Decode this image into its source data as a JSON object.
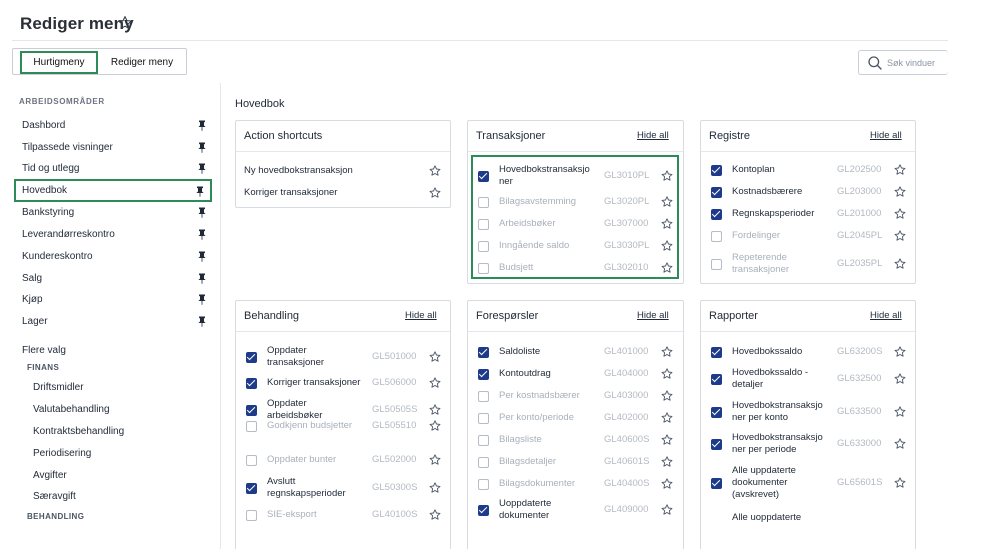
{
  "header": {
    "title": "Rediger meny"
  },
  "toolbar": {
    "tab_quick": "Hurtigmeny",
    "tab_edit": "Rediger meny"
  },
  "search": {
    "placeholder": "Søk vinduer"
  },
  "sidebar": {
    "heading": "ARBEIDSOMRÅDER",
    "items": [
      {
        "label": "Dashbord"
      },
      {
        "label": "Tilpassede visninger"
      },
      {
        "label": "Tid og utlegg"
      },
      {
        "label": "Hovedbok"
      },
      {
        "label": "Bankstyring"
      },
      {
        "label": "Leverandørreskontro"
      },
      {
        "label": "Kundereskontro"
      },
      {
        "label": "Salg"
      },
      {
        "label": "Kjøp"
      },
      {
        "label": "Lager"
      }
    ],
    "more": "Flere valg",
    "cat_finans": "FINANS",
    "finans_items": [
      "Driftsmidler",
      "Valutabehandling",
      "Kontraktsbehandling",
      "Periodisering",
      "Avgifter",
      "Særavgift"
    ],
    "cat_behandling": "BEHANDLING"
  },
  "main": {
    "section_title": "Hovedbok",
    "hide_all": "Hide all",
    "action_shortcuts": {
      "title": "Action shortcuts",
      "items": [
        "Ny hovedbokstransaksjon",
        "Korriger transaksjoner"
      ]
    },
    "transaksjoner": {
      "title": "Transaksjoner",
      "items": [
        {
          "label": "Hovedbokstransaksjo\nner",
          "code": "GL3010PL",
          "checked": true
        },
        {
          "label": "Bilagsavstemming",
          "code": "GL3020PL",
          "checked": false
        },
        {
          "label": "Arbeidsbøker",
          "code": "GL307000",
          "checked": false
        },
        {
          "label": "Inngående saldo",
          "code": "GL3030PL",
          "checked": false
        },
        {
          "label": "Budsjett",
          "code": "GL302010",
          "checked": false
        }
      ]
    },
    "registre": {
      "title": "Registre",
      "items": [
        {
          "label": "Kontoplan",
          "code": "GL202500",
          "checked": true
        },
        {
          "label": "Kostnadsbærere",
          "code": "GL203000",
          "checked": true
        },
        {
          "label": "Regnskapsperioder",
          "code": "GL201000",
          "checked": true
        },
        {
          "label": "Fordelinger",
          "code": "GL2045PL",
          "checked": false
        },
        {
          "label": "Repeterende\ntransaksjoner",
          "code": "GL2035PL",
          "checked": false
        }
      ]
    },
    "behandling": {
      "title": "Behandling",
      "items": [
        {
          "label": "Oppdater\ntransaksjoner",
          "code": "GL501000",
          "checked": true
        },
        {
          "label": "Korriger transaksjoner",
          "code": "GL506000",
          "checked": true
        },
        {
          "label": "Oppdater\narbeidsbøker",
          "code": "GL50505S",
          "checked": true
        },
        {
          "label": "Godkjenn budsjetter",
          "code": "GL505510",
          "checked": false
        },
        {
          "label": "Oppdater bunter",
          "code": "GL502000",
          "checked": false
        },
        {
          "label": "Avslutt\nregnskapsperioder",
          "code": "GL50300S",
          "checked": true
        },
        {
          "label": "SIE-eksport",
          "code": "GL40100S",
          "checked": false
        }
      ]
    },
    "foresporsler": {
      "title": "Forespørsler",
      "items": [
        {
          "label": "Saldoliste",
          "code": "GL401000",
          "checked": true
        },
        {
          "label": "Kontoutdrag",
          "code": "GL404000",
          "checked": true
        },
        {
          "label": "Per kostnadsbærer",
          "code": "GL403000",
          "checked": false
        },
        {
          "label": "Per konto/periode",
          "code": "GL402000",
          "checked": false
        },
        {
          "label": "Bilagsliste",
          "code": "GL40600S",
          "checked": false
        },
        {
          "label": "Bilagsdetaljer",
          "code": "GL40601S",
          "checked": false
        },
        {
          "label": "Bilagsdokumenter",
          "code": "GL40400S",
          "checked": false
        },
        {
          "label": "Uoppdaterte\ndokumenter",
          "code": "GL409000",
          "checked": true
        }
      ]
    },
    "rapporter": {
      "title": "Rapporter",
      "items": [
        {
          "label": "Hovedbokssaldo",
          "code": "GL63200S",
          "checked": true
        },
        {
          "label": "Hovedbokssaldo -\ndetaljer",
          "code": "GL632500",
          "checked": true
        },
        {
          "label": "Hovedbokstransaksjo\nner per konto",
          "code": "GL633500",
          "checked": true
        },
        {
          "label": "Hovedbokstransaksjo\nner per periode",
          "code": "GL633000",
          "checked": true
        },
        {
          "label": "Alle uppdaterte\ndookumenter\n(avskrevet)",
          "code": "GL65601S",
          "checked": true
        },
        {
          "label": "Alle uoppdaterte",
          "code": "",
          "checked": false,
          "partial": true
        }
      ]
    }
  }
}
